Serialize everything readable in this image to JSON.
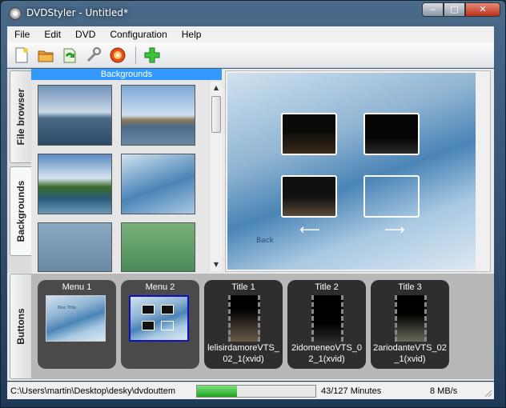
{
  "window": {
    "title": "DVDStyler - Untitled*"
  },
  "window_controls": {
    "minimize": "‒",
    "maximize": "□",
    "close": "✕"
  },
  "menubar": {
    "items": [
      "File",
      "Edit",
      "DVD",
      "Configuration",
      "Help"
    ]
  },
  "toolbar": {
    "buttons": [
      "new-icon",
      "open-icon",
      "save-icon",
      "settings-icon",
      "burn-icon",
      "add-icon"
    ]
  },
  "sidebar": {
    "tabs": [
      "File browser",
      "Backgrounds"
    ],
    "buttons_tab": "Buttons"
  },
  "backgrounds": {
    "header": "Backgrounds",
    "thumbnails": [
      "sea-coast",
      "harbor-ship",
      "lake-shore",
      "blue-waves",
      "blue-haze",
      "green-haze"
    ]
  },
  "menu_canvas": {
    "back_label": "Back",
    "prev_arrow": "⟵",
    "next_arrow": "⟶"
  },
  "titleset": {
    "menus": [
      {
        "title": "Menu 1",
        "preview_title": "Disc Title"
      },
      {
        "title": "Menu 2"
      }
    ],
    "titles": [
      {
        "title": "Title 1",
        "file": "lelisirdamoreVTS_02_1(xvid)"
      },
      {
        "title": "Title 2",
        "file": "2idomeneoVTS_02_1(xvid)"
      },
      {
        "title": "Title 3",
        "file": "2ariodanteVTS_02_1(xvid)"
      }
    ]
  },
  "status": {
    "path": "C:\\Users\\martin\\Desktop\\desky\\dvdouttem",
    "progress": 0.34,
    "minutes": "43/127 Minutes",
    "rate": "8 MB/s"
  }
}
